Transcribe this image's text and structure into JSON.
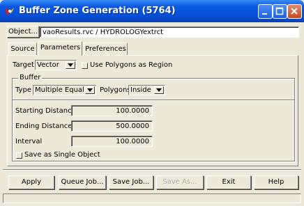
{
  "window": {
    "title": "Buffer Zone Generation (5764)",
    "accent_color": "#0a57e0",
    "icons": [
      "app-icon",
      "minimize-icon",
      "maximize-icon",
      "close-icon"
    ]
  },
  "object": {
    "button_label": "Object...",
    "value": "vaoResults.rvc / HYDROLOGYextrct"
  },
  "tabs": [
    {
      "label": "Source",
      "active": false
    },
    {
      "label": "Parameters",
      "active": true
    },
    {
      "label": "Preferences",
      "active": false
    }
  ],
  "parameters": {
    "target_label": "Target",
    "target_value": "Vector",
    "use_polygons_label": "Use Polygons as Region",
    "buffer_group_label": "Buffer",
    "type_label": "Type",
    "type_value": "Multiple Equal",
    "polygons_label": "Polygons",
    "polygons_value": "Inside",
    "starting_distance_label": "Starting Distance",
    "starting_distance_value": "100.0000",
    "ending_distance_label": "Ending Distance",
    "ending_distance_value": "500.0000",
    "interval_label": "Interval",
    "interval_value": "100.0000",
    "save_single_label": "Save as Single Object"
  },
  "buttons": {
    "apply": "Apply",
    "queue_job": "Queue Job...",
    "save_job": "Save Job...",
    "save_as": "Save As...",
    "exit": "Exit",
    "help": "Help"
  }
}
